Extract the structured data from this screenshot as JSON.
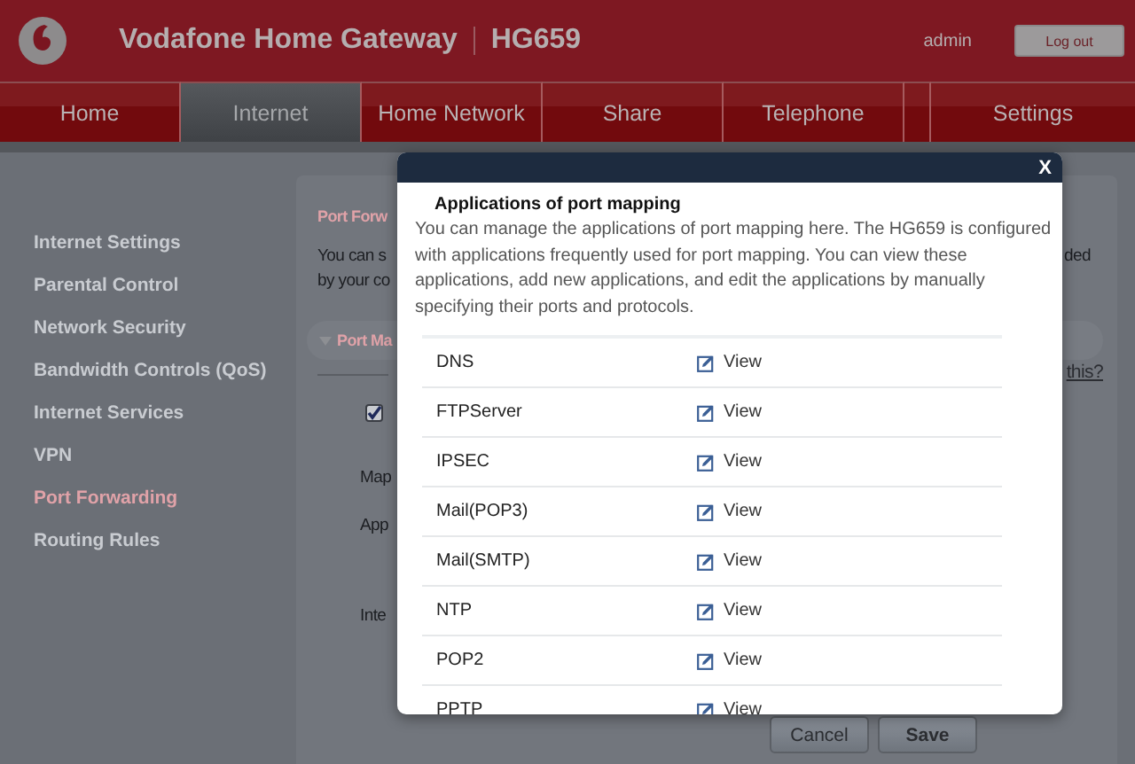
{
  "header": {
    "title": "Vodafone Home Gateway",
    "model": "HG659",
    "user": "admin",
    "logout_button": "Log out"
  },
  "nav_tabs": [
    {
      "kind": "tab",
      "label": "Home",
      "selected": false
    },
    {
      "kind": "tab",
      "label": "Internet",
      "selected": true
    },
    {
      "kind": "tab",
      "label": "Home Network",
      "selected": false
    },
    {
      "kind": "tab",
      "label": "Share",
      "selected": false
    },
    {
      "kind": "tab",
      "label": "Telephone",
      "selected": false
    },
    {
      "kind": "spacer",
      "selected": false
    },
    {
      "kind": "tab",
      "label": "Settings",
      "selected": false
    }
  ],
  "sidebar": {
    "items": [
      {
        "label": "Internet Settings",
        "selected": false
      },
      {
        "label": "Parental Control",
        "selected": false
      },
      {
        "label": "Network Security",
        "selected": false
      },
      {
        "label": "Bandwidth Controls (QoS)",
        "selected": false
      },
      {
        "label": "Internet Services",
        "selected": false
      },
      {
        "label": "VPN",
        "selected": false
      },
      {
        "label": "Port Forwarding",
        "selected": true
      },
      {
        "label": "Routing Rules",
        "selected": false
      }
    ]
  },
  "content": {
    "heading": "Port Forw",
    "intro_lines": [
      "You can s",
      "by your co"
    ],
    "intro_tail": "ded",
    "section": {
      "title": "Port Ma",
      "expanded": true
    },
    "help_link": "this?",
    "enable_checkbox": {
      "checked": true
    },
    "field_labels": [
      "Map",
      "App",
      "Inte"
    ],
    "buttons": [
      "Cancel",
      "Save"
    ]
  },
  "dialog": {
    "close": "X",
    "title": "Applications of port mapping",
    "description": "You can manage the applications of port mapping here. The HG659 is configured with applications frequently used for port mapping. You can view these applications, add new applications, and edit the applications by manually specifying their ports and protocols.",
    "applications": [
      {
        "name": "DNS",
        "action": "View"
      },
      {
        "name": "FTPServer",
        "action": "View"
      },
      {
        "name": "IPSEC",
        "action": "View"
      },
      {
        "name": "Mail(POP3)",
        "action": "View"
      },
      {
        "name": "Mail(SMTP)",
        "action": "View"
      },
      {
        "name": "NTP",
        "action": "View"
      },
      {
        "name": "POP2",
        "action": "View"
      },
      {
        "name": "PPTP",
        "action": "View"
      }
    ]
  }
}
